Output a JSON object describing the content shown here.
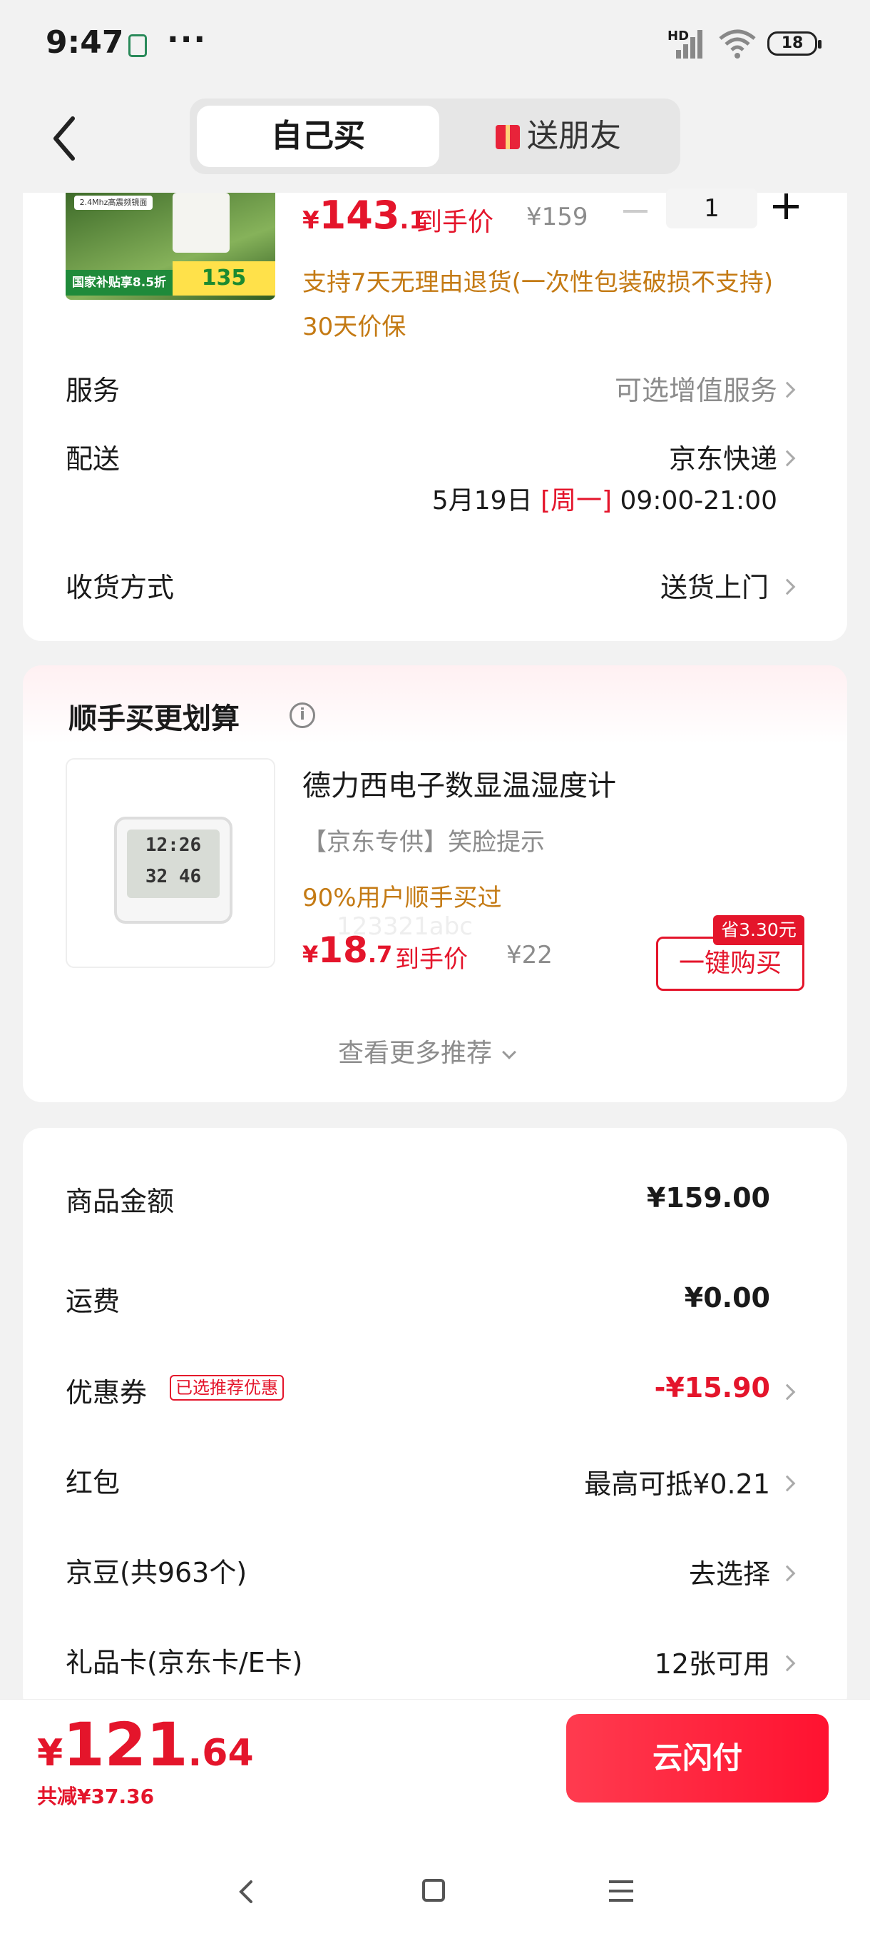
{
  "status": {
    "time": "9:47",
    "dots": "···",
    "battery": "18",
    "network": "HD"
  },
  "tabs": {
    "self": "自己买",
    "friend": "送朋友"
  },
  "product": {
    "price_int": "143",
    "price_dec": ".1",
    "price_label": "到手价",
    "orig_price": "¥159",
    "currency": "¥",
    "quantity": "1",
    "return_policy": "支持7天无理由退货(一次性包装破损不支持)",
    "price_protect": "30天价保",
    "thumb_line1": "2.4Mhz高震频镜面",
    "thumb_line2": "国家补贴享8.5折",
    "thumb_price": "135"
  },
  "rows": {
    "service_label": "服务",
    "service_value": "可选增值服务",
    "delivery_label": "配送",
    "delivery_value": "京东快递",
    "delivery_date": "5月19日",
    "delivery_weekday": "[周一]",
    "delivery_time": "09:00-21:00",
    "receive_label": "收货方式",
    "receive_value": "送货上门"
  },
  "recommend": {
    "title": "顺手买更划算",
    "item_title": "德力西电子数显温湿度计",
    "item_tag": "【京东专供】笑脸提示",
    "item_stat": "90%用户顺手买过",
    "price_int": "18",
    "price_dec": ".7",
    "price_label": "到手价",
    "orig_price": "¥22",
    "save_badge": "省3.30元",
    "buy_button": "一键购买",
    "watermark": "123321abc",
    "more": "查看更多推荐",
    "lcd_top": "12:26",
    "lcd_bottom": "32 46"
  },
  "summary": {
    "goods_label": "商品金额",
    "goods_value": "¥159.00",
    "ship_label": "运费",
    "ship_value": "¥0.00",
    "coupon_label": "优惠券",
    "coupon_badge": "已选推荐优惠",
    "coupon_value": "-¥15.90",
    "redpack_label": "红包",
    "redpack_value": "最高可抵¥0.21",
    "bean_label": "京豆(共963个)",
    "bean_value": "去选择",
    "giftcard_label": "礼品卡(京东卡/E卡)",
    "giftcard_value": "12张可用"
  },
  "footer": {
    "currency": "¥",
    "total_int": "121",
    "total_dec": ".64",
    "discount": "共减¥37.36",
    "pay_button": "云闪付"
  },
  "colors": {
    "accent": "#e4152b",
    "orange": "#c47a14",
    "bg": "#f2f2f2"
  }
}
